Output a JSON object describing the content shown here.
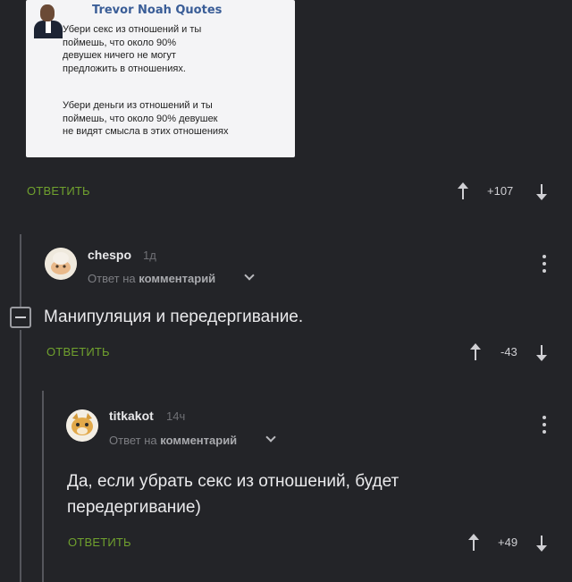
{
  "quote": {
    "title": "Trevor Noah Quotes",
    "paragraph1": "Убери секс из отношений и ты\nпоймешь, что около 90%\nдевушек ничего не могут\nпредложить в отношениях.",
    "paragraph2": "Убери деньги из отношений и ты\nпоймешь, что около 90% девушек\nне видят смысла в этих отношениях"
  },
  "post": {
    "reply_label": "ОТВЕТИТЬ",
    "score": "+107"
  },
  "comments": [
    {
      "user": "chespo",
      "time": "1д",
      "reply_prefix": "Ответ на",
      "reply_target": "комментарий",
      "text": "Манипуляция и передергивание.",
      "reply_label": "ОТВЕТИТЬ",
      "score": "-43"
    },
    {
      "user": "titkakot",
      "time": "14ч",
      "reply_prefix": "Ответ на",
      "reply_target": "комментарий",
      "text": "Да, если убрать секс из отношений, будет\nпередергивание)",
      "reply_label": "ОТВЕТИТЬ",
      "score": "+49"
    }
  ],
  "colors": {
    "background": "#232428",
    "accent_green": "#70a12e",
    "quote_title": "#3a5d97"
  },
  "icons": [
    "upvote-arrow-icon",
    "downvote-arrow-icon",
    "chevron-down-icon",
    "more-vert-icon",
    "collapse-minus-icon"
  ]
}
